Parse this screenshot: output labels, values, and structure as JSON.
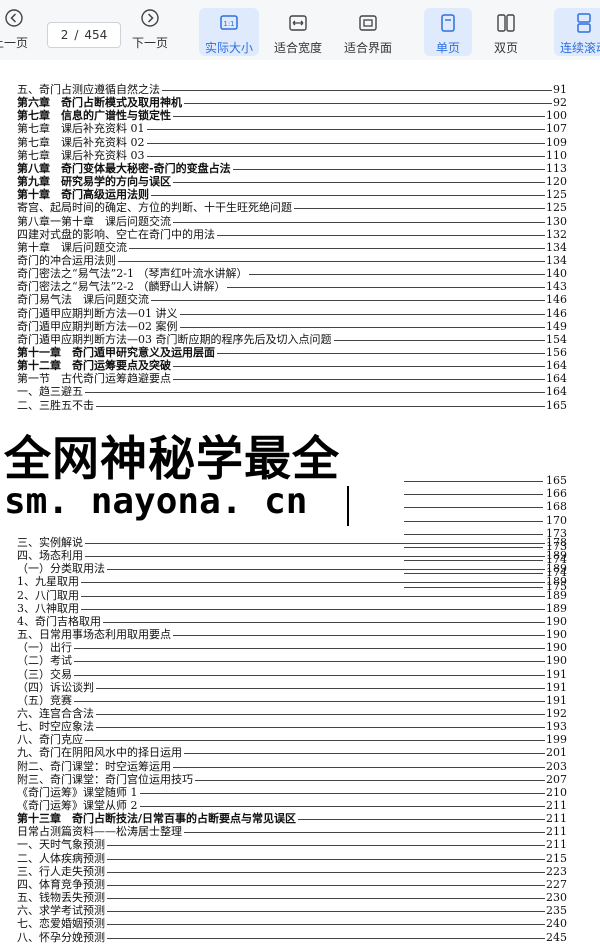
{
  "toolbar": {
    "prev_label": "上一页",
    "page_current": "2",
    "page_sep": "/",
    "page_total": "454",
    "next_label": "下一页",
    "actual_size_label": "实际大小",
    "fit_width_label": "适合宽度",
    "fit_page_label": "适合界面",
    "single_page_label": "单页",
    "double_page_label": "双页",
    "continuous_label": "连续滚动"
  },
  "toc_above": [
    {
      "title": "五、奇门占测应遵循自然之法",
      "page": "91",
      "bold": false
    },
    {
      "title": "第六章　奇门占断模式及取用神机",
      "page": "92",
      "bold": true
    },
    {
      "title": "第七章　信息的广谱性与锁定性",
      "page": "100",
      "bold": true
    },
    {
      "title": "第七章　课后补充资料 01",
      "page": "107",
      "bold": false
    },
    {
      "title": "第七章　课后补充资料 02",
      "page": "109",
      "bold": false
    },
    {
      "title": "第七章　课后补充资料 03",
      "page": "110",
      "bold": false
    },
    {
      "title": "第八章　奇门变体最大秘密-奇门的变盘占法",
      "page": "113",
      "bold": true
    },
    {
      "title": "第九章　研究易学的方向与误区",
      "page": "120",
      "bold": true
    },
    {
      "title": "第十章　奇门高级运用法则",
      "page": "125",
      "bold": true
    },
    {
      "title": "寄宫、起局时间的确定、方位的判断、十干生旺死绝问题",
      "page": "125",
      "bold": false
    },
    {
      "title": "第八章一第十章　课后问题交流",
      "page": "130",
      "bold": false
    },
    {
      "title": "四建对式盘的影响、空亡在奇门中的用法",
      "page": "132",
      "bold": false
    },
    {
      "title": "第十章　课后问题交流",
      "page": "134",
      "bold": false
    },
    {
      "title": "奇门的冲合运用法则",
      "page": "134",
      "bold": false
    },
    {
      "title": "奇门密法之“易气法”2-1 （琴声红叶流水讲解）",
      "page": "140",
      "bold": false
    },
    {
      "title": "奇门密法之“易气法”2-2 （麟野山人讲解）",
      "page": "143",
      "bold": false
    },
    {
      "title": "奇门易气法　课后问题交流",
      "page": "146",
      "bold": false
    },
    {
      "title": "奇门遁甲应期判断方法—01 讲义",
      "page": "146",
      "bold": false
    },
    {
      "title": "奇门遁甲应期判断方法—02 案例",
      "page": "149",
      "bold": false
    },
    {
      "title": "奇门遁甲应期判断方法—03 奇门断应期的程序先后及切入点问题",
      "page": "154",
      "bold": false
    },
    {
      "title": "第十一章　奇门遁甲研究意义及运用层面",
      "page": "156",
      "bold": true
    },
    {
      "title": "第十二章　奇门运筹要点及突破",
      "page": "164",
      "bold": true
    },
    {
      "title": "第一节　古代奇门运筹趋避要点",
      "page": "164",
      "bold": false
    },
    {
      "title": "一、趋三避五",
      "page": "164",
      "bold": false
    },
    {
      "title": "二、三胜五不击",
      "page": "165",
      "bold": false
    }
  ],
  "obscured_pages": [
    "165",
    "166",
    "168",
    "170",
    "173",
    "173",
    "174",
    "174",
    "175"
  ],
  "toc_below": [
    {
      "title": "三、实例解说",
      "page": "178",
      "bold": false,
      "indent": false
    },
    {
      "title": "四、场态利用",
      "page": "189",
      "bold": false,
      "indent": false
    },
    {
      "title": "（一）分类取用法",
      "page": "189",
      "bold": false,
      "indent": false
    },
    {
      "title": "1、九星取用",
      "page": "189",
      "bold": false,
      "indent": false
    },
    {
      "title": "2、八门取用",
      "page": "189",
      "bold": false,
      "indent": false
    },
    {
      "title": "3、八神取用",
      "page": "189",
      "bold": false,
      "indent": false
    },
    {
      "title": "4、奇门吉格取用",
      "page": "190",
      "bold": false,
      "indent": false
    },
    {
      "title": "五、日常用事场态利用取用要点",
      "page": "190",
      "bold": false,
      "indent": false
    },
    {
      "title": "（一）出行",
      "page": "190",
      "bold": false,
      "indent": false
    },
    {
      "title": "（二）考试",
      "page": "190",
      "bold": false,
      "indent": false
    },
    {
      "title": "（三）交易",
      "page": "191",
      "bold": false,
      "indent": false
    },
    {
      "title": "（四）诉讼谈判",
      "page": "191",
      "bold": false,
      "indent": false
    },
    {
      "title": "（五）竞赛",
      "page": "191",
      "bold": false,
      "indent": false
    },
    {
      "title": "六、连宫合含法",
      "page": "192",
      "bold": false,
      "indent": false
    },
    {
      "title": "七、时空应象法",
      "page": "193",
      "bold": false,
      "indent": false
    },
    {
      "title": "八、奇门克应",
      "page": "199",
      "bold": false,
      "indent": false
    },
    {
      "title": "九、奇门在阴阳风水中的择日运用",
      "page": "201",
      "bold": false,
      "indent": false
    },
    {
      "title": "附二、奇门课堂：时空运筹运用",
      "page": "203",
      "bold": false,
      "indent": false
    },
    {
      "title": "附三、奇门课堂：奇门宫位运用技巧",
      "page": "207",
      "bold": false,
      "indent": false
    },
    {
      "title": "《奇门运筹》课堂随师 1",
      "page": "210",
      "bold": false,
      "indent": false
    },
    {
      "title": "《奇门运筹》课堂从师 2",
      "page": "211",
      "bold": false,
      "indent": false
    },
    {
      "title": "第十三章　奇门占断技法/日常百事的占断要点与常见误区",
      "page": "211",
      "bold": true,
      "indent": false
    },
    {
      "title": "日常占测篇资料——松涛居士整理",
      "page": "211",
      "bold": false,
      "indent": false
    },
    {
      "title": "一、天时气象预测",
      "page": "211",
      "bold": false,
      "indent": false
    },
    {
      "title": "二、人体疾病预测",
      "page": "215",
      "bold": false,
      "indent": false
    },
    {
      "title": "三、行人走失预测",
      "page": "223",
      "bold": false,
      "indent": false
    },
    {
      "title": "四、体育竞争预测",
      "page": "227",
      "bold": false,
      "indent": false
    },
    {
      "title": "五、钱物丢失预测",
      "page": "230",
      "bold": false,
      "indent": false
    },
    {
      "title": "六、求学考试预测",
      "page": "235",
      "bold": false,
      "indent": false
    },
    {
      "title": "七、恋爱婚姻预测",
      "page": "240",
      "bold": false,
      "indent": false
    },
    {
      "title": "八、怀孕分娩预测",
      "page": "245",
      "bold": false,
      "indent": false
    }
  ],
  "watermark": {
    "line1": "全网神秘学最全",
    "line2": "sm. nayona. cn"
  }
}
